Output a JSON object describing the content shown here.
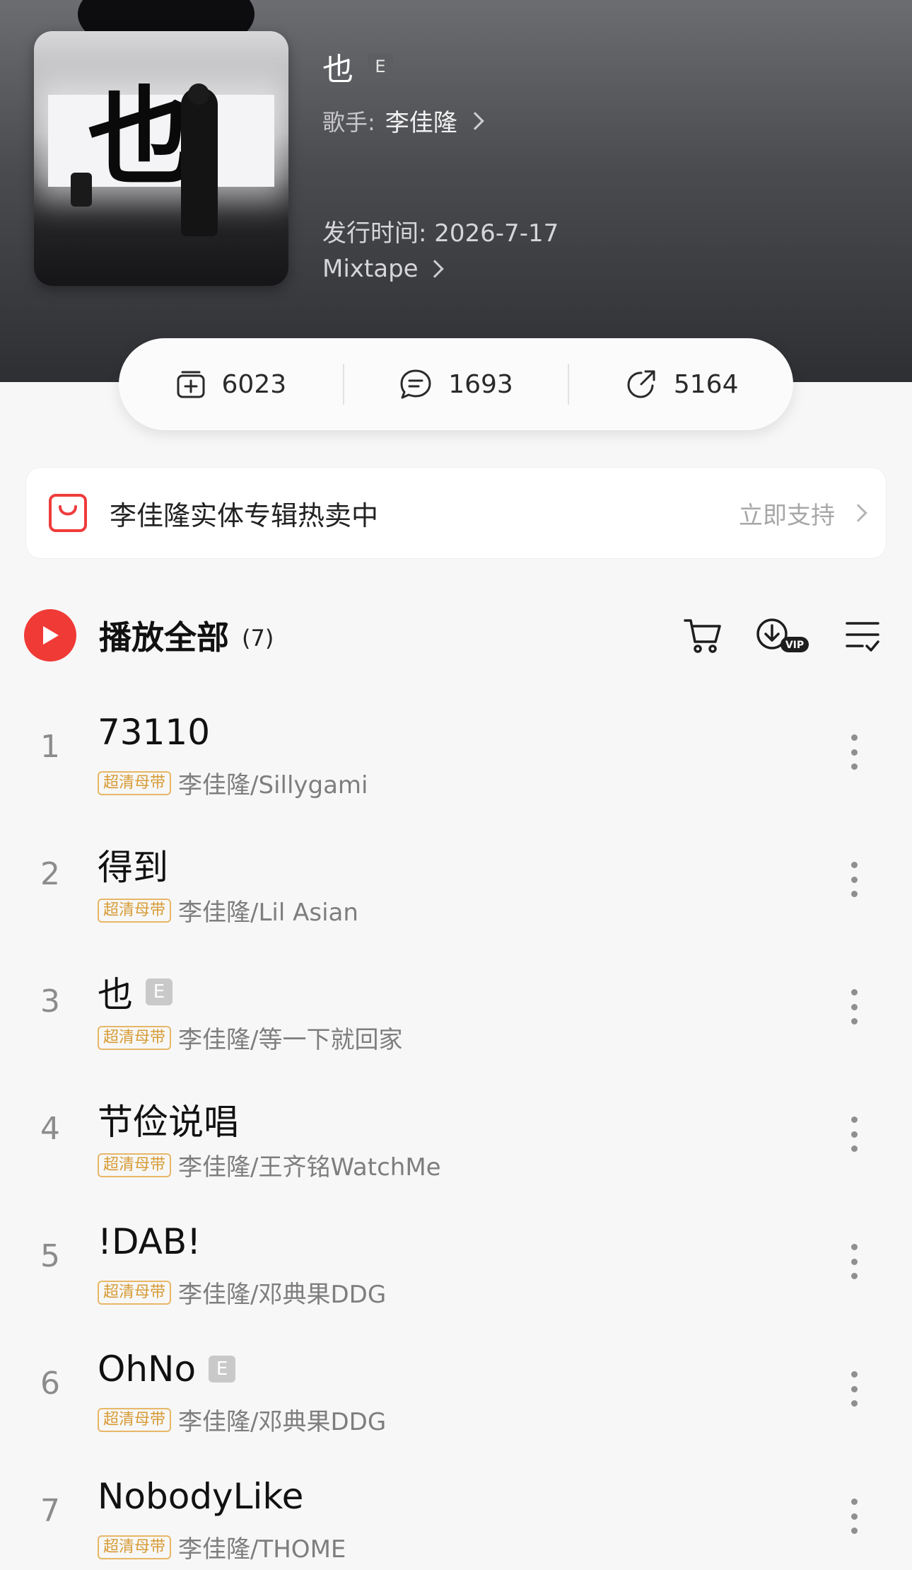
{
  "album": {
    "cover_glyph": "也",
    "title": "也",
    "explicit_badge": "E",
    "artist_label": "歌手:",
    "artist_name": "李佳隆",
    "release": "发行时间: 2026-7-17",
    "type": "Mixtape"
  },
  "stats": {
    "collect": "6023",
    "comments": "1693",
    "shares": "5164"
  },
  "promo": {
    "text": "李佳隆实体专辑热卖中",
    "link": "立即支持"
  },
  "playall": {
    "label": "播放全部",
    "count": "(7)"
  },
  "icons": {
    "cart": "shopping-cart-icon",
    "download": "download-vip-icon",
    "manage": "list-manage-icon",
    "play": "play-icon",
    "more": "more-vertical-icon",
    "bag": "shopping-bag-icon"
  },
  "colors": {
    "accent_red": "#f03a36",
    "quality_gold": "#d79b35"
  },
  "tracks": [
    {
      "num": "1",
      "title": "73110",
      "explicit": false,
      "quality": "超清母带",
      "artists": "李佳隆/Sillygami"
    },
    {
      "num": "2",
      "title": "得到",
      "explicit": false,
      "quality": "超清母带",
      "artists": "李佳隆/Lil Asian"
    },
    {
      "num": "3",
      "title": "也",
      "explicit": true,
      "badge": "E",
      "quality": "超清母带",
      "artists": "李佳隆/等一下就回家"
    },
    {
      "num": "4",
      "title": "节俭说唱",
      "explicit": false,
      "quality": "超清母带",
      "artists": "李佳隆/王齐铭WatchMe"
    },
    {
      "num": "5",
      "title": "!DAB!",
      "explicit": false,
      "quality": "超清母带",
      "artists": "李佳隆/邓典果DDG"
    },
    {
      "num": "6",
      "title": "OhNo",
      "explicit": true,
      "badge": "E",
      "quality": "超清母带",
      "artists": "李佳隆/邓典果DDG"
    },
    {
      "num": "7",
      "title": "NobodyLike",
      "explicit": false,
      "quality": "超清母带",
      "artists": "李佳隆/THOME"
    }
  ]
}
